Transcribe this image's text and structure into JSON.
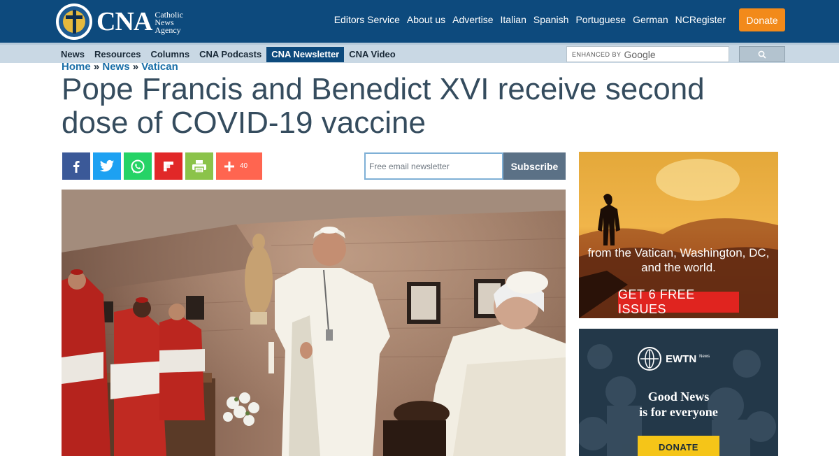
{
  "header": {
    "logo": {
      "wordmark": "CNA",
      "sub_lines": [
        "Catholic",
        "News",
        "Agency"
      ]
    },
    "nav": [
      "Editors Service",
      "About us",
      "Advertise",
      "Italian",
      "Spanish",
      "Portuguese",
      "German",
      "NCRegister"
    ],
    "donate_label": "Donate",
    "accent_color": "#0d4a7d",
    "donate_color": "#f28a1a"
  },
  "subnav": {
    "items": [
      {
        "label": "News",
        "active": false
      },
      {
        "label": "Resources",
        "active": false
      },
      {
        "label": "Columns",
        "active": false
      },
      {
        "label": "CNA Podcasts",
        "active": false
      },
      {
        "label": "CNA Newsletter",
        "active": true
      },
      {
        "label": "CNA Video",
        "active": false
      }
    ],
    "search": {
      "enhanced_label": "ENHANCED BY",
      "provider": "Google",
      "button_icon": "search-icon"
    }
  },
  "breadcrumb": {
    "items": [
      "Home",
      "News",
      "Vatican"
    ],
    "separator": "»"
  },
  "article": {
    "title": "Pope Francis and Benedict XVI receive second dose of COVID-19 vaccine"
  },
  "share": {
    "buttons": [
      {
        "icon": "facebook-icon",
        "color": "#3b5998"
      },
      {
        "icon": "twitter-icon",
        "color": "#1da1f2"
      },
      {
        "icon": "whatsapp-icon",
        "color": "#25d366"
      },
      {
        "icon": "flipboard-icon",
        "color": "#e12828"
      },
      {
        "icon": "print-icon",
        "color": "#8bc34a"
      }
    ],
    "more": {
      "icon": "plus-icon",
      "count": "40",
      "color": "#ff6550"
    }
  },
  "newsletter": {
    "placeholder": "Free email newsletter",
    "button_label": "Subscribe"
  },
  "ads": {
    "ad1": {
      "text_line1": "from the Vatican, Washington, DC,",
      "text_line2": "and the world.",
      "cta": "GET 6 FREE ISSUES"
    },
    "ad2": {
      "brand": "EWTN",
      "brand_sub": "News",
      "tag_line1": "Good News",
      "tag_line2": "is for everyone",
      "cta": "DONATE"
    }
  }
}
